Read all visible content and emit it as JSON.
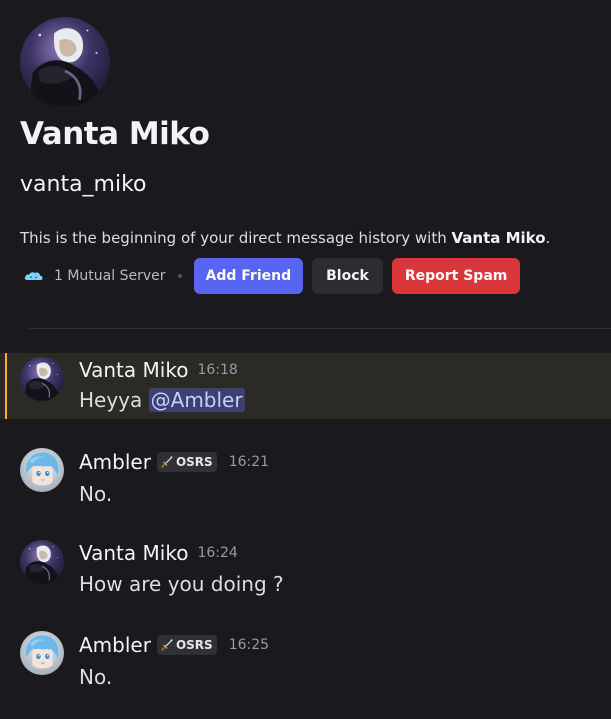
{
  "intro": {
    "display_name": "Vanta Miko",
    "username": "vanta_miko",
    "history_prefix": "This is the beginning of your direct message history with ",
    "history_name": "Vanta Miko",
    "history_suffix": ".",
    "mutual_servers": "1 Mutual Server",
    "buttons": {
      "add_friend": "Add Friend",
      "block": "Block",
      "report_spam": "Report Spam"
    }
  },
  "messages": [
    {
      "author": "Vanta Miko",
      "time": "16:18",
      "text": "Heyya ",
      "mention": "@Ambler",
      "highlighted": true,
      "avatar_icon": "vanta-miko-avatar"
    },
    {
      "author": "Ambler",
      "tag": "OSRS",
      "tag_icon": "sword-icon",
      "time": "16:21",
      "text": "No.",
      "avatar_icon": "ambler-avatar"
    },
    {
      "author": "Vanta Miko",
      "time": "16:24",
      "text": "How are you doing ?",
      "avatar_icon": "vanta-miko-avatar"
    },
    {
      "author": "Ambler",
      "tag": "OSRS",
      "tag_icon": "sword-icon",
      "time": "16:25",
      "text": "No.",
      "avatar_icon": "ambler-avatar"
    }
  ],
  "colors": {
    "background": "#1a1a1e",
    "brand": "#5865f2",
    "danger": "#da373c",
    "mention_highlight": "#f0b232"
  }
}
